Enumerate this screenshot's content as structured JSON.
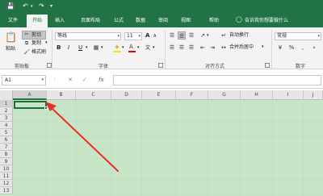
{
  "quick_access": {
    "icons": [
      "save-icon",
      "undo-icon",
      "redo-icon",
      "customize-icon"
    ]
  },
  "tabs": [
    {
      "label": "文件"
    },
    {
      "label": "开始"
    },
    {
      "label": "插入"
    },
    {
      "label": "页面布局"
    },
    {
      "label": "公式"
    },
    {
      "label": "数据"
    },
    {
      "label": "审阅"
    },
    {
      "label": "视图"
    },
    {
      "label": "帮助"
    }
  ],
  "tell_me": "告诉我你想要做什么",
  "ribbon": {
    "clipboard": {
      "paste": "粘贴",
      "cut": "剪切",
      "copy": "复制",
      "format_painter": "格式刷",
      "label": "剪贴板"
    },
    "font": {
      "name": "等线",
      "size": "11",
      "bold": "B",
      "italic": "I",
      "underline": "U",
      "font_color_letter": "A",
      "grow": "A",
      "shrink": "A",
      "wen": "文",
      "label": "字体"
    },
    "alignment": {
      "wrap": "自动换行",
      "merge": "合并后居中",
      "label": "对齐方式"
    },
    "number": {
      "format": "常规",
      "label": "数字"
    }
  },
  "formula_bar": {
    "name_box": "A1",
    "fx": "fx"
  },
  "grid": {
    "columns": [
      "A",
      "B",
      "C",
      "D",
      "E",
      "F",
      "G",
      "H",
      "I",
      "J"
    ],
    "rows": [
      "1",
      "2",
      "3",
      "4",
      "5",
      "6",
      "7",
      "8",
      "9",
      "10",
      "11",
      "12",
      "13"
    ],
    "active_cell": "A1",
    "fill_color": "#c8e5c8"
  },
  "colors": {
    "brand": "#217346",
    "arrow": "#e8302a",
    "selection": "#1e6e3a"
  }
}
